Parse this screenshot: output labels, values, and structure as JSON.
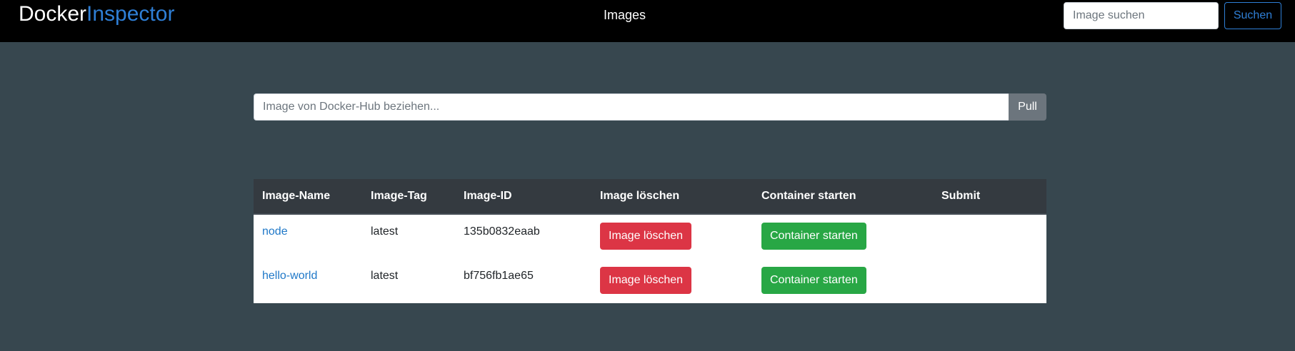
{
  "navbar": {
    "brand_part1": "Docker",
    "brand_part2": "Inspector",
    "nav_link": "Images",
    "search_placeholder": "Image suchen",
    "search_button": "Suchen"
  },
  "pull": {
    "placeholder": "Image von Docker-Hub beziehen...",
    "button": "Pull"
  },
  "table": {
    "headers": [
      "Image-Name",
      "Image-Tag",
      "Image-ID",
      "Image löschen",
      "Container starten",
      "Submit"
    ],
    "rows": [
      {
        "name": "node",
        "tag": "latest",
        "id": "135b0832eaab",
        "delete_label": "Image löschen",
        "start_label": "Container starten"
      },
      {
        "name": "hello-world",
        "tag": "latest",
        "id": "bf756fb1ae65",
        "delete_label": "Image löschen",
        "start_label": "Container starten"
      }
    ]
  },
  "colors": {
    "navbar_bg": "#000000",
    "page_bg": "#37474f",
    "accent": "#2f7fd6",
    "danger": "#dc3545",
    "success": "#28a745",
    "table_header_bg": "#343a40"
  }
}
